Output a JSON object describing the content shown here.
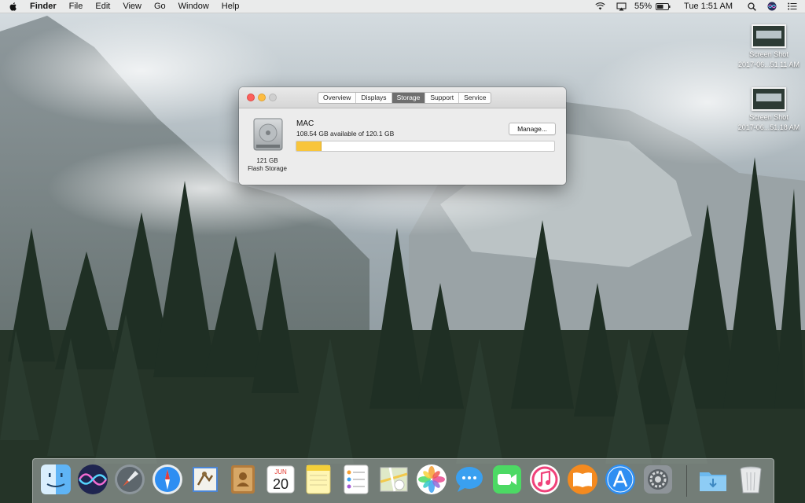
{
  "menubar": {
    "app_name": "Finder",
    "menus": [
      "File",
      "Edit",
      "View",
      "Go",
      "Window",
      "Help"
    ],
    "battery_percent": "55%",
    "clock": "Tue 1:51 AM"
  },
  "desktop": {
    "files": [
      {
        "name": "Screen Shot",
        "date": "2017-06...51.11 AM"
      },
      {
        "name": "Screen Shot",
        "date": "2017-06...51.18 AM"
      }
    ]
  },
  "window": {
    "tabs": [
      "Overview",
      "Displays",
      "Storage",
      "Support",
      "Service"
    ],
    "active_tab": "Storage",
    "disk_size": "121 GB",
    "disk_type": "Flash Storage",
    "volume_name": "MAC",
    "available_text": "108.54 GB available of 120.1 GB",
    "used_fraction": 0.096,
    "manage_label": "Manage..."
  },
  "dock": {
    "apps": [
      {
        "name": "Finder",
        "icon": "finder-icon",
        "running": true
      },
      {
        "name": "Siri",
        "icon": "siri-icon",
        "running": false
      },
      {
        "name": "Launchpad",
        "icon": "launchpad-icon",
        "running": false
      },
      {
        "name": "Safari",
        "icon": "safari-icon",
        "running": true
      },
      {
        "name": "Mail",
        "icon": "mail-icon",
        "running": false
      },
      {
        "name": "Contacts",
        "icon": "contacts-icon",
        "running": false
      },
      {
        "name": "Calendar",
        "icon": "calendar-icon",
        "running": false,
        "month": "JUN",
        "day": "20"
      },
      {
        "name": "Notes",
        "icon": "notes-icon",
        "running": false
      },
      {
        "name": "Reminders",
        "icon": "reminders-icon",
        "running": false
      },
      {
        "name": "Maps",
        "icon": "maps-icon",
        "running": false
      },
      {
        "name": "Photos",
        "icon": "photos-icon",
        "running": false
      },
      {
        "name": "Messages",
        "icon": "messages-icon",
        "running": false
      },
      {
        "name": "FaceTime",
        "icon": "facetime-icon",
        "running": false
      },
      {
        "name": "iTunes",
        "icon": "itunes-icon",
        "running": false
      },
      {
        "name": "iBooks",
        "icon": "ibooks-icon",
        "running": false
      },
      {
        "name": "App Store",
        "icon": "appstore-icon",
        "running": false
      },
      {
        "name": "System Preferences",
        "icon": "system-preferences-icon",
        "running": false
      },
      {
        "name": "Downloads",
        "icon": "downloads-folder-icon",
        "running": false
      },
      {
        "name": "Trash",
        "icon": "trash-icon",
        "running": false
      }
    ]
  },
  "colors": {
    "storage_used": "#f8c53b",
    "close": "#fc605c",
    "minimize": "#fdbc40"
  }
}
